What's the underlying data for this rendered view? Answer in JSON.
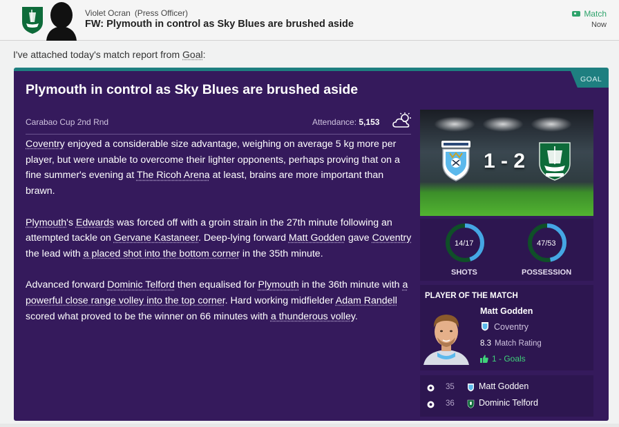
{
  "header": {
    "sender_name": "Violet Ocran",
    "sender_role": "(Press Officer)",
    "subject": "FW: Plymouth in control as Sky Blues are brushed aside",
    "tag": "Match",
    "time": "Now"
  },
  "intro": {
    "before": "I've attached today's match report from ",
    "source": "Goal",
    "after": ":"
  },
  "report": {
    "source_badge": "GOAL",
    "headline": "Plymouth in control as Sky Blues are brushed aside",
    "competition": "Carabao Cup 2nd Rnd",
    "attendance_label": "Attendance:",
    "attendance_value": "5,153",
    "weather_icon": "partly-cloudy-icon"
  },
  "paragraphs": {
    "p1": {
      "team": "Coventry",
      "text1": " enjoyed a considerable size advantage, weighing on average 5 kg more per player, but were unable to overcome their lighter opponents, perhaps proving that on a fine summer's evening at ",
      "venue": "The Ricoh Arena",
      "text2": " at least, brains are more important than brawn."
    },
    "p2": {
      "team1": "Plymouth",
      "t1": "'s ",
      "player1": "Edwards",
      "t2": " was forced off with a groin strain in the 27th minute following an attempted tackle on ",
      "player2": "Gervane Kastaneer",
      "t3": ". Deep-lying forward ",
      "player3": "Matt Godden",
      "t4": " gave ",
      "team2": "Coventry",
      "t5": " the lead with ",
      "goal": "a placed shot into the bottom corner",
      "t6": " in the 35th minute."
    },
    "p3": {
      "t1": "Advanced forward ",
      "player1": "Dominic Telford",
      "t2": " then equalised for ",
      "team1": "Plymouth",
      "t3": " in the 36th minute with ",
      "goal1": "a powerful close range volley into the top corner",
      "t4": ". Hard working midfielder ",
      "player2": "Adam Randell",
      "t5": " scored what proved to be the winner on 66 minutes with ",
      "goal2": "a thunderous volley",
      "t6": "."
    }
  },
  "scoreline": {
    "home_team_crest": "coventry-crest",
    "away_team_crest": "plymouth-crest",
    "score": "1 - 2"
  },
  "stats": {
    "shots": {
      "value": "14/17",
      "label": "SHOTS",
      "fraction": 0.4516
    },
    "possession": {
      "value": "47/53",
      "label": "POSSESSION",
      "fraction": 0.47
    }
  },
  "player_of_match": {
    "title": "PLAYER OF THE MATCH",
    "name": "Matt Godden",
    "club": "Coventry",
    "rating": "8.3",
    "rating_label": "Match Rating",
    "goals": "1 - Goals"
  },
  "events": [
    {
      "minute": "35",
      "player": "Matt Godden",
      "team": "coventry"
    },
    {
      "minute": "36",
      "player": "Dominic Telford",
      "team": "plymouth"
    }
  ],
  "colors": {
    "card_bg": "#351a5c",
    "panel_bg": "#2d1650",
    "accent_teal": "#1e7f80",
    "ring_blue": "#45a6e5",
    "ring_green": "#0f4f28",
    "goal_green": "#3fd37a"
  }
}
